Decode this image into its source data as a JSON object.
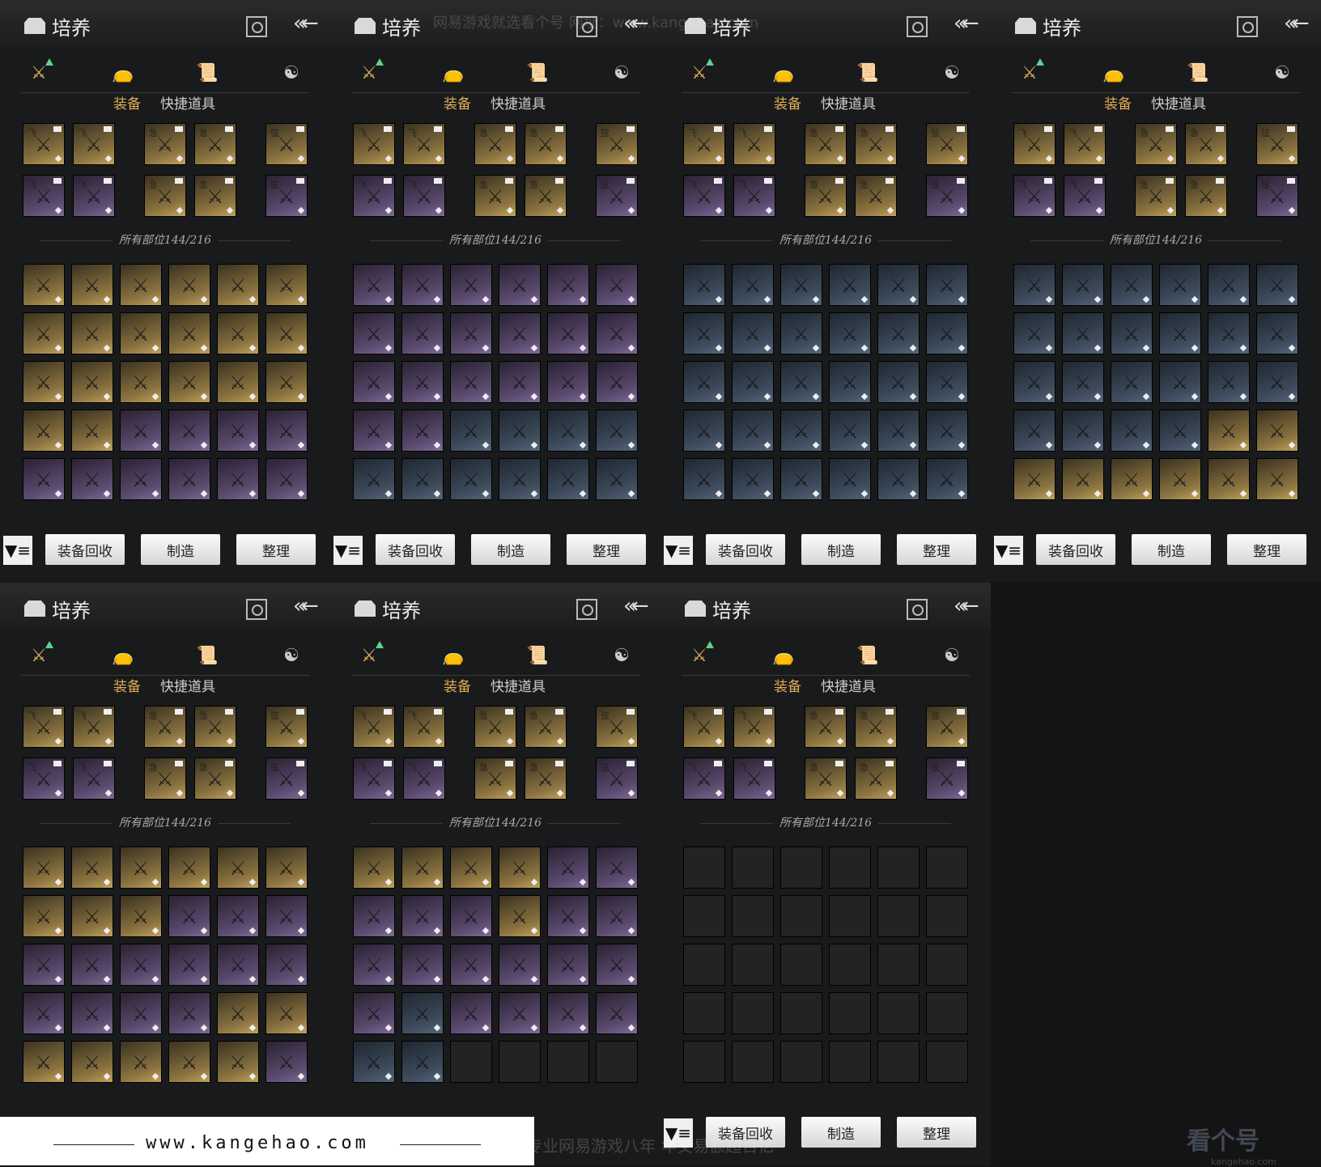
{
  "panel": {
    "title": "培养",
    "subtabs": [
      "装备",
      "快捷道具"
    ],
    "parts_label": "所有部位144/216",
    "buttons": {
      "recycle": "装备回收",
      "craft": "制造",
      "sort": "整理"
    },
    "category_icons": [
      "crossed-swords-icon",
      "pouch-icon",
      "scroll-icon",
      "cultivation-icon"
    ]
  },
  "panels": [
    {
      "row": 0,
      "col": 0,
      "grid_tiers": [
        "gold",
        "gold",
        "gold",
        "gold",
        "gold",
        "gold",
        "gold",
        "gold",
        "gold",
        "gold",
        "gold",
        "gold",
        "gold",
        "gold",
        "gold",
        "gold",
        "gold",
        "gold",
        "gold",
        "gold",
        "purple",
        "purple",
        "purple",
        "purple",
        "purple",
        "purple",
        "purple",
        "purple",
        "purple",
        "purple"
      ],
      "show_bottom": true
    },
    {
      "row": 0,
      "col": 1,
      "grid_tiers": [
        "purple",
        "purple",
        "purple",
        "purple",
        "purple",
        "purple",
        "purple",
        "purple",
        "purple",
        "purple",
        "purple",
        "purple",
        "purple",
        "purple",
        "purple",
        "purple",
        "purple",
        "purple",
        "purple",
        "purple",
        "blue",
        "blue",
        "blue",
        "blue",
        "blue",
        "blue",
        "blue",
        "blue",
        "blue",
        "blue"
      ],
      "show_bottom": true
    },
    {
      "row": 0,
      "col": 2,
      "grid_tiers": [
        "blue",
        "blue",
        "blue",
        "blue",
        "blue",
        "blue",
        "blue",
        "blue",
        "blue",
        "blue",
        "blue",
        "blue",
        "blue",
        "blue",
        "blue",
        "blue",
        "blue",
        "blue",
        "blue",
        "blue",
        "blue",
        "blue",
        "blue",
        "blue",
        "blue",
        "blue",
        "blue",
        "blue",
        "blue",
        "blue"
      ],
      "show_bottom": true
    },
    {
      "row": 0,
      "col": 3,
      "grid_tiers": [
        "blue",
        "blue",
        "blue",
        "blue",
        "blue",
        "blue",
        "blue",
        "blue",
        "blue",
        "blue",
        "blue",
        "blue",
        "blue",
        "blue",
        "blue",
        "blue",
        "blue",
        "blue",
        "blue",
        "blue",
        "blue",
        "blue",
        "gold",
        "gold",
        "gold",
        "gold",
        "gold",
        "gold",
        "gold",
        "gold"
      ],
      "show_bottom": true
    },
    {
      "row": 1,
      "col": 0,
      "grid_tiers": [
        "gold",
        "gold",
        "gold",
        "gold",
        "gold",
        "gold",
        "gold",
        "gold",
        "gold",
        "purple",
        "purple",
        "purple",
        "purple",
        "purple",
        "purple",
        "purple",
        "purple",
        "purple",
        "purple",
        "purple",
        "purple",
        "purple",
        "gold",
        "gold",
        "gold",
        "gold",
        "gold",
        "gold",
        "gold",
        "purple"
      ],
      "show_bottom": false
    },
    {
      "row": 1,
      "col": 1,
      "grid_tiers": [
        "gold",
        "gold",
        "gold",
        "gold",
        "purple",
        "purple",
        "purple",
        "purple",
        "purple",
        "gold",
        "purple",
        "purple",
        "purple",
        "purple",
        "purple",
        "purple",
        "purple",
        "purple",
        "purple",
        "blue",
        "purple",
        "purple",
        "purple",
        "purple",
        "blue",
        "blue",
        "empty",
        "empty",
        "empty",
        "empty"
      ],
      "show_bottom": false
    },
    {
      "row": 1,
      "col": 2,
      "grid_tiers": [
        "empty",
        "empty",
        "empty",
        "empty",
        "empty",
        "empty",
        "empty",
        "empty",
        "empty",
        "empty",
        "empty",
        "empty",
        "empty",
        "empty",
        "empty",
        "empty",
        "empty",
        "empty",
        "empty",
        "empty",
        "empty",
        "empty",
        "empty",
        "empty",
        "empty",
        "empty",
        "empty",
        "empty",
        "empty",
        "empty"
      ],
      "show_bottom": true
    }
  ],
  "equipped_chars": [
    "飞",
    "飞",
    "急",
    "急",
    "弦",
    "飞",
    "飞",
    "急",
    "急",
    "弦"
  ],
  "equipped_tiers": [
    "gold",
    "gold",
    "gold",
    "gold",
    "gold",
    "purple",
    "purple",
    "gold",
    "gold",
    "purple"
  ],
  "watermark_top": "网易游戏就选看个号  网址：www.kangehao.com",
  "watermark_bottom": "看个号专业网易游戏八年 年交易额超百亿",
  "footer_url": "www.kangehao.com",
  "logo_text": "看个号",
  "logo_sub": "kangehao.com",
  "colors": {
    "accent": "#e1ae57",
    "upgrade": "#5fd38a"
  }
}
